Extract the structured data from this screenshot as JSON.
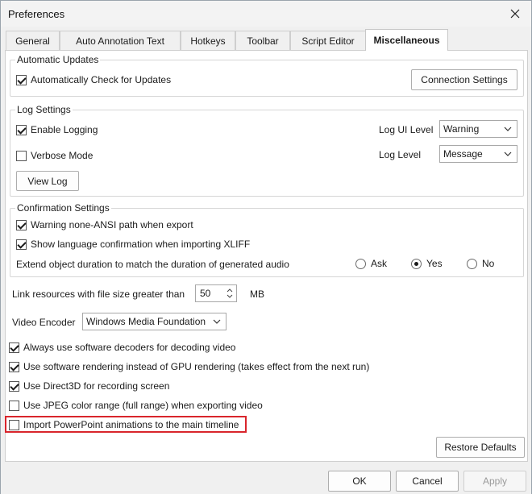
{
  "window": {
    "title": "Preferences",
    "close_icon": "close-icon"
  },
  "tabs": [
    {
      "label": "General",
      "active": false
    },
    {
      "label": "Auto Annotation Text",
      "active": false
    },
    {
      "label": "Hotkeys",
      "active": false
    },
    {
      "label": "Toolbar",
      "active": false
    },
    {
      "label": "Script Editor",
      "active": false
    },
    {
      "label": "Miscellaneous",
      "active": true
    }
  ],
  "automatic_updates": {
    "title": "Automatic Updates",
    "auto_check_label": "Automatically Check for Updates",
    "auto_check_checked": true,
    "connection_settings_label": "Connection Settings"
  },
  "log_settings": {
    "title": "Log Settings",
    "enable_logging_label": "Enable Logging",
    "enable_logging_checked": true,
    "verbose_mode_label": "Verbose Mode",
    "verbose_mode_checked": false,
    "view_log_label": "View Log",
    "log_ui_level_label": "Log UI Level",
    "log_ui_level_value": "Warning",
    "log_level_label": "Log Level",
    "log_level_value": "Message"
  },
  "confirmation_settings": {
    "title": "Confirmation Settings",
    "warning_path_label": "Warning none-ANSI path when export",
    "warning_path_checked": true,
    "show_language_label": "Show language confirmation when importing XLIFF",
    "show_language_checked": true,
    "extend_duration_label": "Extend object duration to match the duration of generated audio",
    "options": [
      "Ask",
      "Yes",
      "No"
    ],
    "selected": "Yes"
  },
  "misc": {
    "link_resources_label": "Link resources with file size greater than",
    "link_resources_value": "50",
    "link_resources_unit": "MB",
    "video_encoder_label": "Video Encoder",
    "video_encoder_value": "Windows Media Foundation",
    "checkboxes": [
      {
        "label": "Always use software decoders for decoding video",
        "checked": true
      },
      {
        "label": "Use software rendering instead of GPU rendering (takes effect from the next run)",
        "checked": true
      },
      {
        "label": "Use Direct3D for recording screen",
        "checked": true
      },
      {
        "label": "Use JPEG color range (full range) when exporting video",
        "checked": false
      },
      {
        "label": "Import PowerPoint animations to the main timeline",
        "checked": false
      }
    ],
    "restore_defaults_label": "Restore Defaults"
  },
  "footer": {
    "ok_label": "OK",
    "cancel_label": "Cancel",
    "apply_label": "Apply"
  },
  "colors": {
    "highlight": "#d9252c"
  }
}
